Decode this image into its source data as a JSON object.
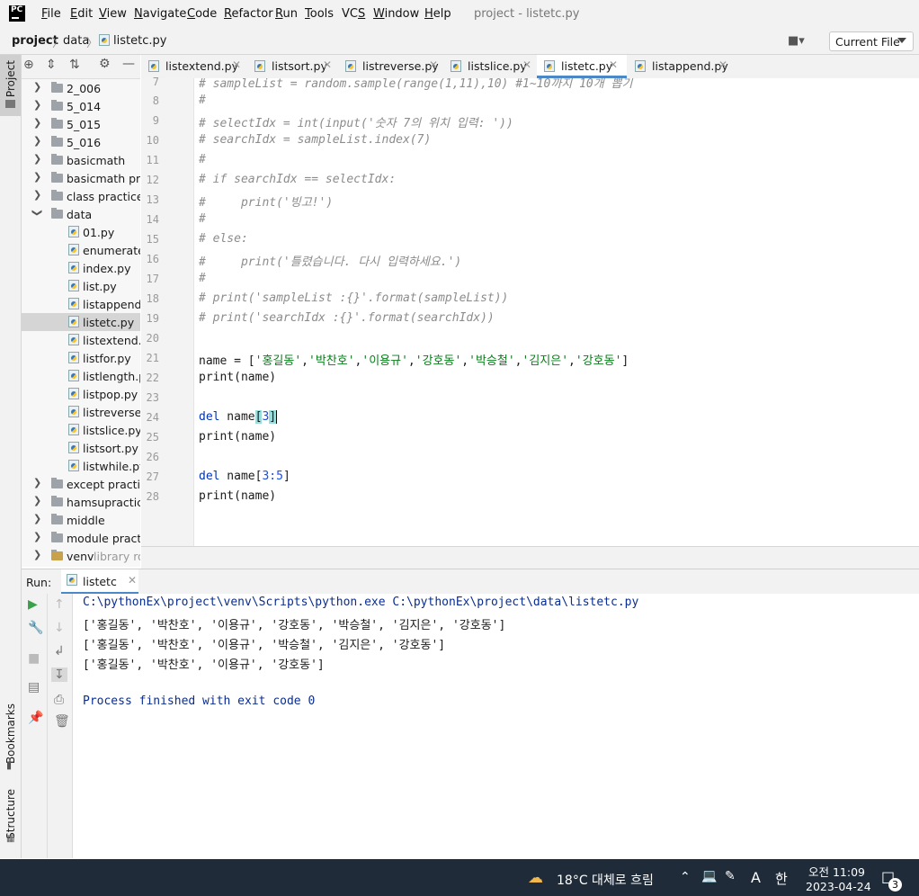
{
  "menubar": {
    "logo": "PC",
    "items": [
      "File",
      "Edit",
      "View",
      "Navigate",
      "Code",
      "Refactor",
      "Run",
      "Tools",
      "VCS",
      "Window",
      "Help"
    ],
    "underline": [
      "F",
      "E",
      "V",
      "N",
      "C",
      "R",
      "R",
      "T",
      "S",
      "W",
      "H"
    ],
    "title": "project - listetc.py"
  },
  "navbar": {
    "crumbs": [
      "project",
      "data",
      "listetc.py"
    ],
    "run_config": "Current File"
  },
  "sidebar": {
    "project_tab": "Project",
    "bookmarks_tab": "Bookmarks",
    "structure_tab": "Structure"
  },
  "tree": {
    "folders_top": [
      "2_006",
      "5_014",
      "5_015",
      "5_016",
      "basicmath",
      "basicmath prac",
      "class practice",
      "data"
    ],
    "files": [
      "01.py",
      "enumerate.p",
      "index.py",
      "list.py",
      "listappend.p",
      "listetc.py",
      "listextend.py",
      "listfor.py",
      "listlength.py",
      "listpop.py",
      "listreverse.py",
      "listslice.py",
      "listsort.py",
      "listwhile.py"
    ],
    "folders_bottom": [
      "except practice",
      "hamsupractice",
      "middle",
      "module practic",
      "venv"
    ],
    "venv_note": "library roo",
    "selected": "listetc.py"
  },
  "tabs": [
    {
      "label": "listextend.py"
    },
    {
      "label": "listsort.py"
    },
    {
      "label": "listreverse.py"
    },
    {
      "label": "listslice.py"
    },
    {
      "label": "listetc.py",
      "active": true
    },
    {
      "label": "listappend.py"
    }
  ],
  "editor": {
    "line_numbers": [
      "7",
      "8",
      "9",
      "10",
      "11",
      "12",
      "13",
      "14",
      "15",
      "16",
      "17",
      "18",
      "19",
      "20",
      "21",
      "22",
      "23",
      "24",
      "25",
      "26",
      "27",
      "28"
    ],
    "comment_lines": [
      "# sampleList = random.sample(range(1,11),10) #1~10까지 10개 뽑기",
      "#",
      "# selectIdx = int(input('숫자 7의 위치 입력: '))",
      "# searchIdx = sampleList.index(7)",
      "#",
      "# if searchIdx == selectIdx:",
      "#     print('빙고!')",
      "#",
      "# else:",
      "#     print('틀렸습니다. 다시 입력하세요.')",
      "#",
      "# print('sampleList :{}'.format(sampleList))",
      "# print('searchIdx :{}'.format(searchIdx))"
    ],
    "names": [
      "'홍길동'",
      "'박찬호'",
      "'이용규'",
      "'강호동'",
      "'박승철'",
      "'김지은'",
      "'강호동'"
    ],
    "print_line": "print(name)",
    "del_keyword": "del",
    "del1_index": "3",
    "del2_slice": "3:5"
  },
  "run": {
    "label": "Run:",
    "tab": "listetc",
    "command": "C:\\pythonEx\\project\\venv\\Scripts\\python.exe C:\\pythonEx\\project\\data\\listetc.py",
    "output": [
      "['홍길동', '박찬호', '이용규', '강호동', '박승철', '김지은', '강호동']",
      "['홍길동', '박찬호', '이용규', '박승철', '김지은', '강호동']",
      "['홍길동', '박찬호', '이용규', '강호동']"
    ],
    "finish": "Process finished with exit code 0"
  },
  "taskbar": {
    "weather": "18°C 대체로 흐림",
    "ime_a": "A",
    "ime_han": "한",
    "time": "오전 11:09",
    "date": "2023-04-24",
    "notif_count": "3"
  }
}
